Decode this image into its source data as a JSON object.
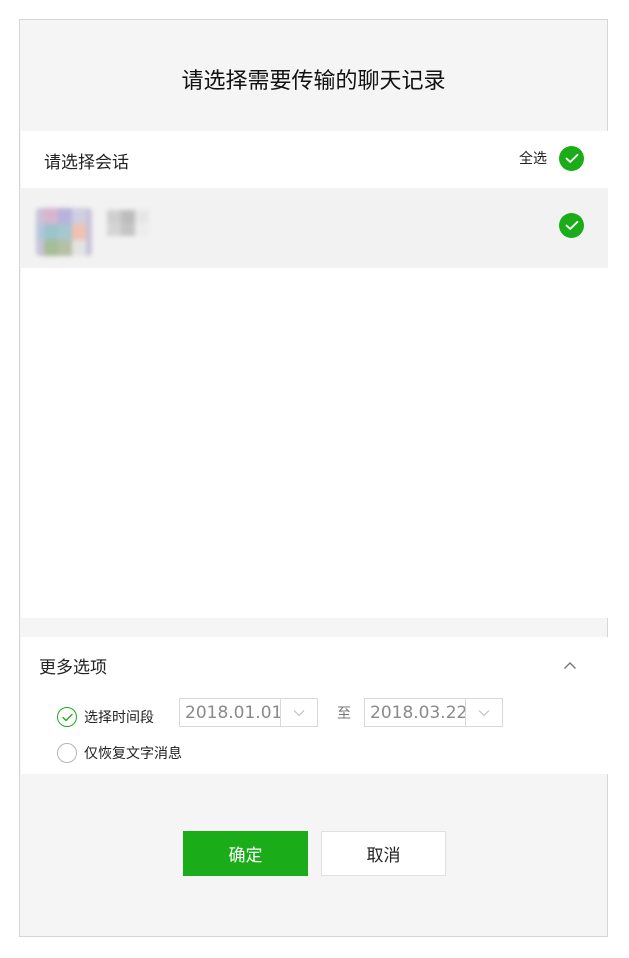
{
  "dialog": {
    "title": "请选择需要传输的聊天记录"
  },
  "conversations": {
    "header_label": "请选择会话",
    "select_all_label": "全选",
    "items": [
      {
        "selected": true
      }
    ]
  },
  "more_options": {
    "label": "更多选项",
    "expanded": true,
    "time_range": {
      "label": "选择时间段",
      "checked": true,
      "start": "2018.01.01",
      "to_label": "至",
      "end": "2018.03.22"
    },
    "text_only": {
      "label": "仅恢复文字消息",
      "checked": false
    }
  },
  "buttons": {
    "confirm": "确定",
    "cancel": "取消"
  },
  "colors": {
    "accent": "#1aad19"
  }
}
